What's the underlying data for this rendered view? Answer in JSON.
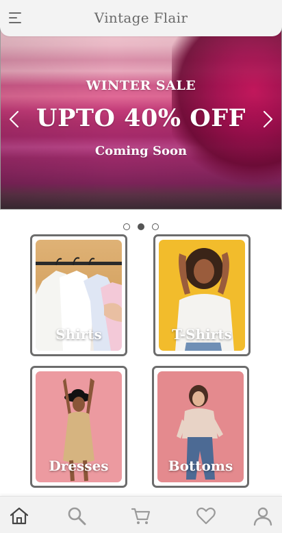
{
  "header": {
    "brand": "Vintage Flair",
    "menu_icon": "hamburger-menu-icon"
  },
  "hero": {
    "kicker": "WINTER SALE",
    "title": "UPTO 40% OFF",
    "subtitle": "Coming Soon",
    "prev_icon": "chevron-left-icon",
    "next_icon": "chevron-right-icon",
    "slides_total": 3,
    "active_slide": 2
  },
  "categories": [
    {
      "label": "Shirts"
    },
    {
      "label": "T-Shirts"
    },
    {
      "label": "Dresses"
    },
    {
      "label": "Bottoms"
    }
  ],
  "bottom_nav": [
    {
      "icon": "home-icon",
      "active": true
    },
    {
      "icon": "search-icon",
      "active": false
    },
    {
      "icon": "cart-icon",
      "active": false
    },
    {
      "icon": "heart-icon",
      "active": false
    },
    {
      "icon": "profile-icon",
      "active": false
    }
  ],
  "colors": {
    "header_bg": "#f3f3f3",
    "brand_text": "#6a6a6a",
    "card_border": "#6c6c6c",
    "nav_bg": "#f2f2f2",
    "nav_icon_active": "#444444",
    "nav_icon_inactive": "#9a9a9a"
  }
}
